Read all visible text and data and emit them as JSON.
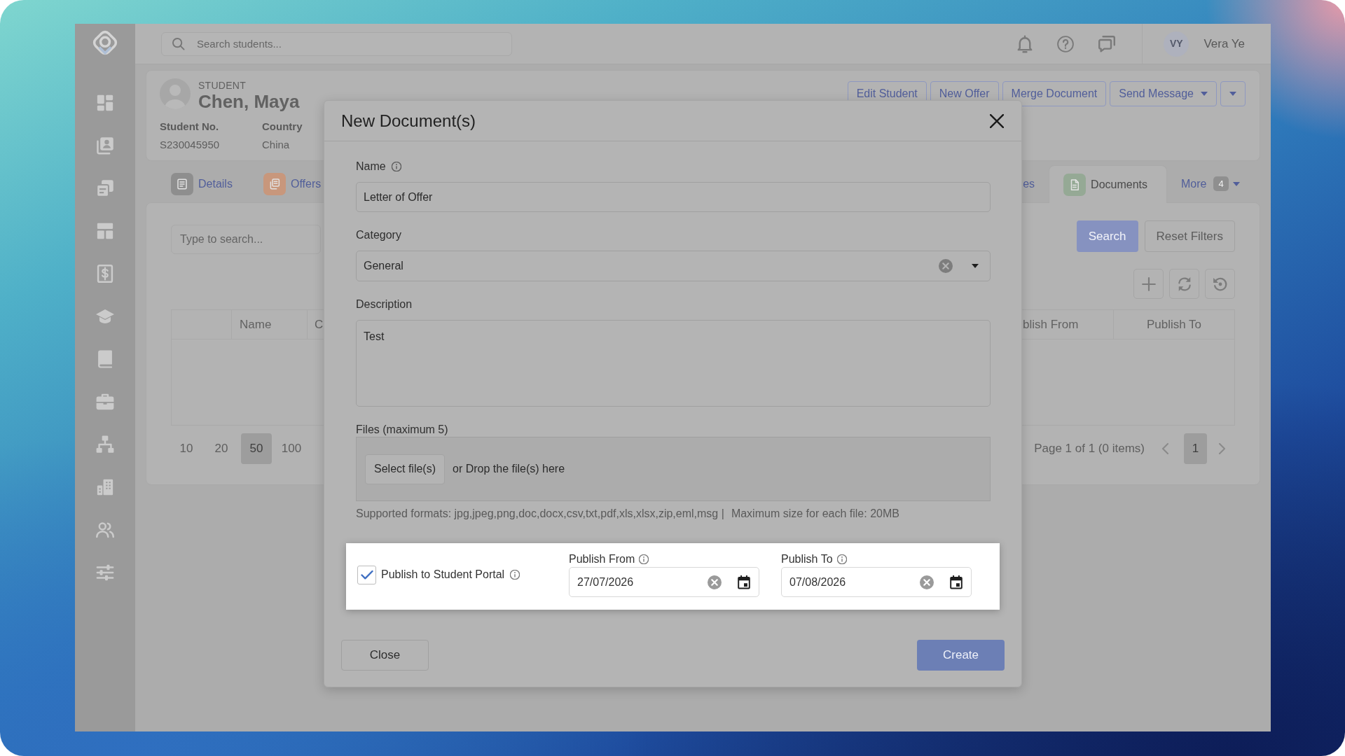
{
  "top_bar": {
    "search": {
      "placeholder": "Search students..."
    },
    "user": {
      "initials": "VY",
      "name": "Vera Ye"
    }
  },
  "student": {
    "caption": "STUDENT",
    "name": "Chen, Maya",
    "fields": [
      {
        "label": "Student No.",
        "value": "S230045950"
      },
      {
        "label": "Country",
        "value": "China"
      }
    ],
    "actions": [
      {
        "kind": "button",
        "label": "Edit Student"
      },
      {
        "kind": "button",
        "label": "New Offer"
      },
      {
        "kind": "button",
        "label": "Merge Document"
      },
      {
        "kind": "dropdown",
        "label": "Send Message"
      },
      {
        "kind": "caret"
      }
    ]
  },
  "tabs": [
    {
      "label": "Details",
      "color": "#8e8e8e",
      "selected": false
    },
    {
      "label": "Offers",
      "color": "#c8977c",
      "selected": false
    },
    {
      "label": "es",
      "selected": false
    },
    {
      "label": "Documents",
      "color": "#95a995",
      "selected": true
    }
  ],
  "more_menu": {
    "label": "More",
    "count": "4"
  },
  "documents": {
    "search": {
      "placeholder": "Type to search..."
    },
    "buttons": [
      {
        "kind": "primary",
        "label": "Search"
      },
      {
        "kind": "secondary",
        "label": "Reset Filters"
      }
    ],
    "table": {
      "columns": [
        "Name",
        "C",
        "blish From",
        "Publish To"
      ]
    },
    "page_sizes": [
      {
        "label": "10",
        "selected": false
      },
      {
        "label": "20",
        "selected": false
      },
      {
        "label": "50",
        "selected": true
      },
      {
        "label": "100",
        "selected": false
      }
    ],
    "page_summary": "Page 1 of 1 (0 items)",
    "pages": [
      {
        "label": "1",
        "selected": true
      }
    ]
  },
  "modal": {
    "title": "New Document(s)",
    "fields": [
      {
        "kind": "text",
        "label": "Name",
        "info": true,
        "value": "Letter of Offer"
      },
      {
        "kind": "select",
        "label": "Category",
        "value": "General"
      },
      {
        "kind": "textarea",
        "label": "Description",
        "value": "Test"
      },
      {
        "kind": "files",
        "label": "Files (maximum 5)",
        "button": "Select file(s)",
        "drop_text": "or Drop the file(s) here"
      }
    ],
    "hints": [
      "Supported formats: jpg,jpeg,png,doc,docx,csv,txt,pdf,xls,xlsx,zip,eml,msg |",
      "Maximum size for each file: 20MB"
    ],
    "publish": {
      "checked": true,
      "label": "Publish to Student Portal",
      "info": true,
      "dates": [
        {
          "label": "Publish From",
          "info": true,
          "value": "27/07/2026"
        },
        {
          "label": "Publish To",
          "info": true,
          "value": "07/08/2026"
        }
      ]
    },
    "buttons": [
      {
        "kind": "secondary",
        "label": "Close"
      },
      {
        "kind": "primary",
        "label": "Create"
      }
    ]
  }
}
